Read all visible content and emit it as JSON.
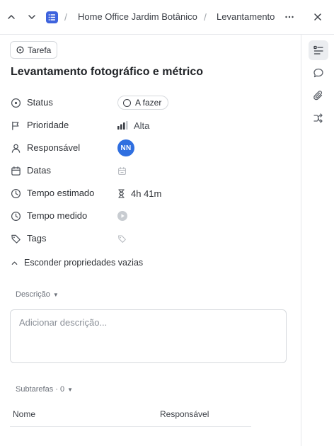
{
  "breadcrumb": {
    "items": [
      "Home Office Jardim Botânico",
      "Levantamento"
    ],
    "separator": "/"
  },
  "task": {
    "type_label": "Tarefa",
    "title": "Levantamento fotográfico e métrico"
  },
  "properties": {
    "status": {
      "label": "Status",
      "value": "A fazer"
    },
    "priority": {
      "label": "Prioridade",
      "value": "Alta"
    },
    "assignee": {
      "label": "Responsável",
      "initials": "NN"
    },
    "dates": {
      "label": "Datas"
    },
    "estimate": {
      "label": "Tempo estimado",
      "value": "4h 41m"
    },
    "tracked": {
      "label": "Tempo medido"
    },
    "tags": {
      "label": "Tags"
    }
  },
  "hide_empty_label": "Esconder propriedades vazias",
  "description": {
    "header": "Descrição",
    "placeholder": "Adicionar descrição..."
  },
  "subtasks": {
    "header": "Subtarefas · 0",
    "columns": [
      "Nome",
      "Responsável"
    ]
  },
  "colors": {
    "accent": "#3e63dd",
    "avatar": "#2f6fe0",
    "border": "#d6d9dd"
  },
  "icons": {
    "rail": [
      "details-icon",
      "comment-icon",
      "attachment-icon",
      "relationship-icon"
    ]
  }
}
